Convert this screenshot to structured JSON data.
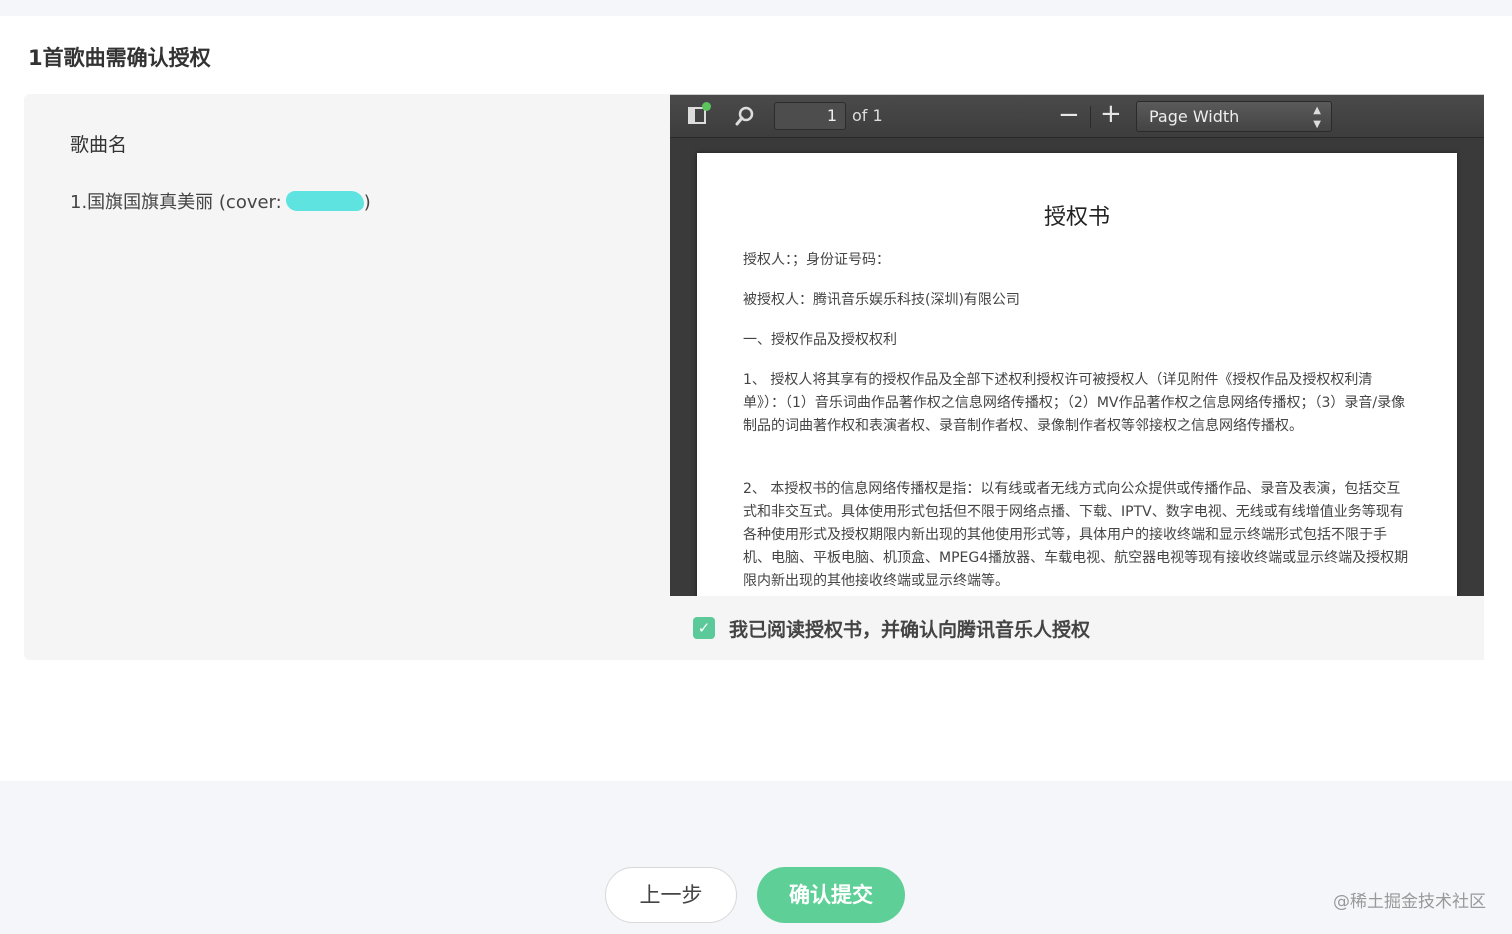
{
  "page": {
    "heading": "1首歌曲需确认授权"
  },
  "song_list": {
    "column_title": "歌曲名",
    "items": [
      {
        "label": "1.国旗国旗真美丽 (cover:",
        "suffix": ")"
      }
    ]
  },
  "pdf_viewer": {
    "page_number": "1",
    "page_of": "of 1",
    "zoom_out": "−",
    "zoom_in": "+",
    "zoom_value": "Page Width",
    "document": {
      "title": "授权书",
      "paragraphs": [
        "授权人：；身份证号码：",
        "被授权人：腾讯音乐娱乐科技(深圳)有限公司",
        "一、授权作品及授权权利",
        "1、 授权人将其享有的授权作品及全部下述权利授权许可被授权人（详见附件《授权作品及授权权利清单》）：（1）音乐词曲作品著作权之信息网络传播权；（2）MV作品著作权之信息网络传播权；（3）录音/录像制品的词曲著作权和表演者权、录音制作者权、录像制作者权等邻接权之信息网络传播权。",
        "2、 本授权书的信息网络传播权是指：以有线或者无线方式向公众提供或传播作品、录音及表演，包括交互式和非交互式。具体使用形式包括但不限于网络点播、下载、IPTV、数字电视、无线或有线增值业务等现有各种使用形式及授权期限内新出现的其他使用形式等，具体用户的接收终端和显示终端形式包括不限于手机、电脑、平板电脑、机顶盒、MPEG4播放器、车载电视、航空器电视等现有接收终端或显示终端及授权期限内新出现的其他接收终端或显示终端等。"
      ]
    }
  },
  "consent": {
    "checked": true,
    "label": "我已阅读授权书，并确认向腾讯音乐人授权"
  },
  "footer": {
    "prev_label": "上一步",
    "submit_label": "确认提交",
    "watermark": "@稀土掘金技术社区"
  },
  "colors": {
    "accent": "#5fcf98",
    "checkbox": "#5bc99a",
    "viewer_dark": "#3a3a3a"
  }
}
